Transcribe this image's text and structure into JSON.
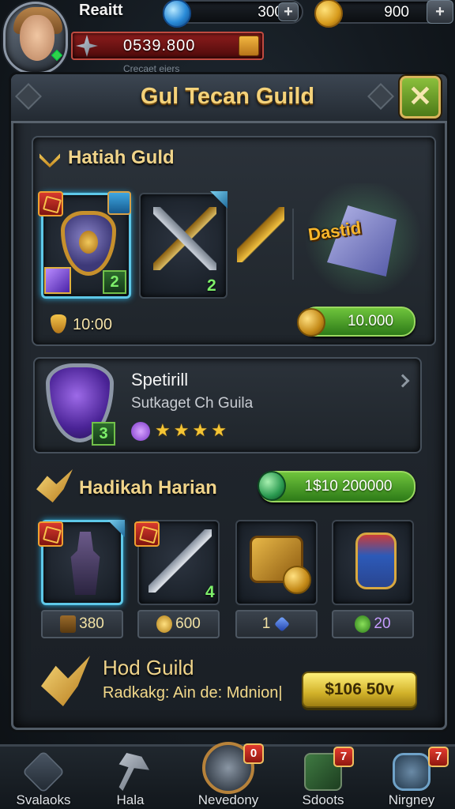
{
  "hud": {
    "player_name": "Reaitt",
    "gems": "300",
    "gold": "900",
    "power": "0539.800",
    "ticker": "Crecaet eiers"
  },
  "panel": {
    "title": "Gul Tecan Guild"
  },
  "guild_section": {
    "title": "Hatiah Guld",
    "card1_level": "2",
    "card2_level": "2",
    "emblem_label": "Dastid",
    "cost_left": "10:00",
    "cost_button": "10.000"
  },
  "spec_section": {
    "title": "Spetirill",
    "subtitle": "Sutkaget Ch  Guila",
    "badge": "3",
    "stars_on": 4
  },
  "shop_section": {
    "title": "Hadikah Harian",
    "buy_button": "1$10 200000",
    "items": [
      {
        "price": "380",
        "icon": "book-icon"
      },
      {
        "price": "600",
        "icon": "coin-icon"
      },
      {
        "price": "1",
        "icon": "blue-gem-icon"
      },
      {
        "price": "20",
        "icon": "check-icon"
      }
    ],
    "item2_level": "4"
  },
  "footer": {
    "title": "Hod Guild",
    "subtitle": "Radkakg: Ain de: Mdnion|",
    "button": "$106 50v"
  },
  "nav": [
    {
      "label": "Svalaoks",
      "badge": ""
    },
    {
      "label": "Hala",
      "badge": ""
    },
    {
      "label": "Nevedony",
      "badge": "0"
    },
    {
      "label": "Sdoots",
      "badge": "7"
    },
    {
      "label": "Nirgney",
      "badge": "7"
    }
  ],
  "colors": {
    "gold_text": "#f4d27a",
    "green_button": "#6fc43c",
    "yellow_button": "#fff07a",
    "badge_red": "#e23a2e"
  }
}
